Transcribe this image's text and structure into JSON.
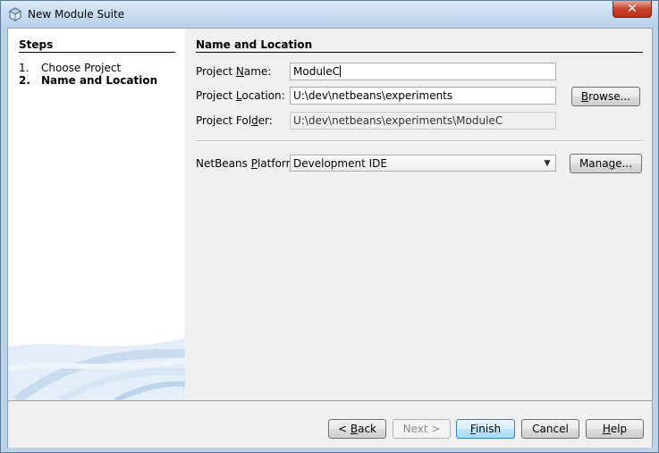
{
  "window": {
    "title": "New Module Suite",
    "close_glyph": "✕"
  },
  "steps": {
    "title": "Steps",
    "items": [
      {
        "num": "1.",
        "label": "Choose Project"
      },
      {
        "num": "2.",
        "label": "Name and Location"
      }
    ]
  },
  "form": {
    "section_title": "Name and Location",
    "project_name": {
      "label_pre": "Project ",
      "label_mn": "N",
      "label_post": "ame:",
      "value": "ModuleC"
    },
    "project_location": {
      "label_pre": "Project ",
      "label_mn": "L",
      "label_post": "ocation:",
      "value": "U:\\dev\\netbeans\\experiments"
    },
    "project_folder": {
      "label_pre": "Project Fol",
      "label_mn": "d",
      "label_post": "er:",
      "value": "U:\\dev\\netbeans\\experiments\\ModuleC"
    },
    "platform": {
      "label_pre": "NetBeans ",
      "label_mn": "P",
      "label_post": "latform:",
      "value": "Development IDE"
    },
    "browse_button": {
      "pre": "",
      "mn": "B",
      "post": "rowse..."
    },
    "manage_button": {
      "pre": "Mana",
      "mn": "g",
      "post": "e..."
    }
  },
  "buttons": {
    "back": {
      "pre": "< ",
      "mn": "B",
      "post": "ack"
    },
    "next": "Next >",
    "finish": {
      "pre": "",
      "mn": "F",
      "post": "inish"
    },
    "cancel": "Cancel",
    "help": {
      "pre": "",
      "mn": "H",
      "post": "elp"
    }
  },
  "colors": {
    "title_bar": "#c4d9ef",
    "close_button": "#c7432b",
    "default_button": "#bee6fd"
  },
  "icons": {
    "app": "netbeans-cube-icon",
    "combo": "chevron-down-icon"
  }
}
